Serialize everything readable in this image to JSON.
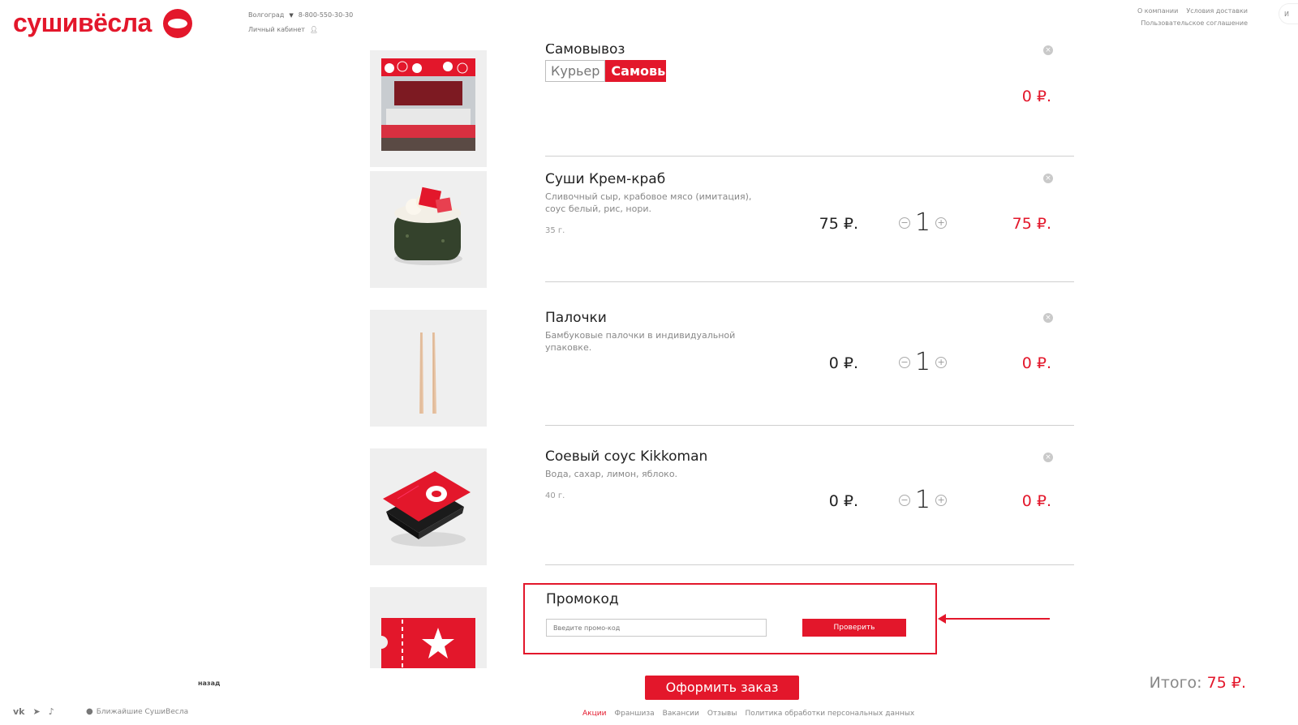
{
  "brand": {
    "logo_text": "сушивёсла",
    "color": "#e3172b"
  },
  "header": {
    "city": "Волгоград",
    "phone": "8-800-550-30-30",
    "account": "Личный кабинет",
    "links_row1": [
      "О компании",
      "Условия доставки"
    ],
    "links_row2": [
      "Пользовательское соглашение"
    ],
    "side_tab": "И"
  },
  "delivery": {
    "title": "Самовывоз",
    "options": [
      "Курьер",
      "Самовывоз"
    ],
    "selected": "Самовывоз",
    "total": "0 ₽."
  },
  "items": [
    {
      "name": "Суши Крем-краб",
      "description": "Сливочный сыр, крабовое мясо (имитация), соус белый, рис, нори.",
      "weight": "35 г.",
      "price": "75 ₽.",
      "quantity": "1",
      "total": "75 ₽.",
      "image": "sushi-image"
    },
    {
      "name": "Палочки",
      "description": "Бамбуковые палочки в индивидуальной упаковке.",
      "weight": "",
      "price": "0 ₽.",
      "quantity": "1",
      "total": "0 ₽.",
      "image": "chopsticks-image"
    },
    {
      "name": "Соевый соус Kikkoman",
      "description": "Вода, сахар, лимон, яблоко.",
      "weight": "40 г.",
      "price": "0 ₽.",
      "quantity": "1",
      "total": "0 ₽.",
      "image": "soy-sauce-image"
    }
  ],
  "promo": {
    "title": "Промокод",
    "placeholder": "Введите промо-код",
    "button": "Проверить"
  },
  "checkout": {
    "button": "Оформить заказ",
    "total_label": "Итого:",
    "total_value": "75 ₽."
  },
  "footer": {
    "back": "назад",
    "social": [
      "vk-icon",
      "telegram-icon",
      "tiktok-icon"
    ],
    "nearest": "Ближайшие СушиВесла",
    "links": [
      "Акции",
      "Франшиза",
      "Вакансии",
      "Отзывы",
      "Политика обработки персональных данных"
    ],
    "active_link": "Акции"
  }
}
